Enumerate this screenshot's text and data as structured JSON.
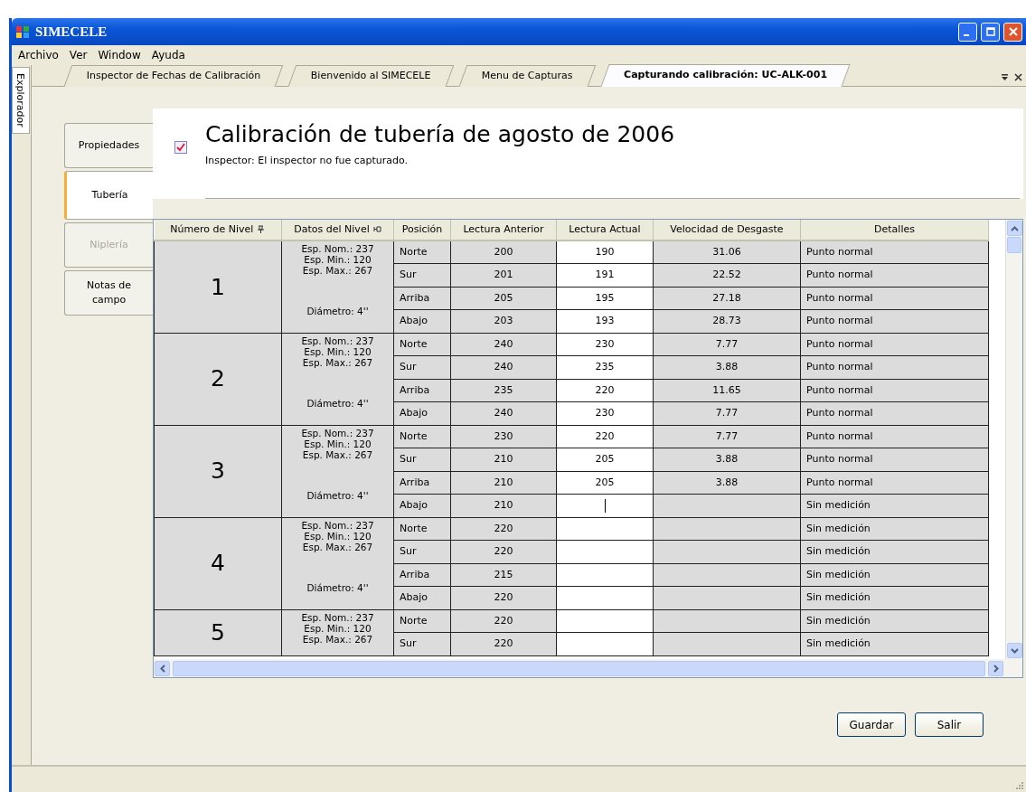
{
  "window": {
    "title": "SIMECELE"
  },
  "menu": [
    "Archivo",
    "Ver",
    "Window",
    "Ayuda"
  ],
  "side_panel": {
    "label": "Explorador"
  },
  "doc_tabs": [
    {
      "label": "Inspector de Fechas de Calibración",
      "selected": false
    },
    {
      "label": "Bienvenido al SIMECELE",
      "selected": false
    },
    {
      "label": "Menu  de Capturas",
      "selected": false
    },
    {
      "label": "Capturando calibración: UC-ALK-001",
      "selected": true
    }
  ],
  "section_tabs": [
    {
      "label": "Propiedades",
      "selected": false,
      "disabled": false
    },
    {
      "label": "Tubería",
      "selected": true,
      "disabled": false
    },
    {
      "label": "Niplería",
      "selected": false,
      "disabled": true
    },
    {
      "label": "Notas de campo",
      "selected": false,
      "disabled": false
    }
  ],
  "header": {
    "checked": true,
    "title": "Calibración de tubería de agosto de 2006",
    "subtitle": "Inspector: El inspector no fue capturado."
  },
  "grid": {
    "columns": [
      {
        "label": "Número de Nivel",
        "pinned": true
      },
      {
        "label": "Datos del Nivel",
        "pinned": true
      },
      {
        "label": "Posición",
        "pinned": false
      },
      {
        "label": "Lectura Anterior",
        "pinned": false
      },
      {
        "label": "Lectura Actual",
        "pinned": false
      },
      {
        "label": "Velocidad de Desgaste",
        "pinned": false
      },
      {
        "label": "Detalles",
        "pinned": false
      }
    ],
    "levels": [
      {
        "number": "1",
        "specs": [
          "Esp. Nom.: 237",
          "Esp. Min.: 120",
          "Esp. Max.: 267"
        ],
        "diameter": "Diámetro: 4''",
        "readings": [
          {
            "position": "Norte",
            "previous": "200",
            "current": "190",
            "rate": "31.06",
            "details": "Punto normal"
          },
          {
            "position": "Sur",
            "previous": "201",
            "current": "191",
            "rate": "22.52",
            "details": "Punto normal"
          },
          {
            "position": "Arriba",
            "previous": "205",
            "current": "195",
            "rate": "27.18",
            "details": "Punto normal"
          },
          {
            "position": "Abajo",
            "previous": "203",
            "current": "193",
            "rate": "28.73",
            "details": "Punto normal"
          }
        ]
      },
      {
        "number": "2",
        "specs": [
          "Esp. Nom.: 237",
          "Esp. Min.: 120",
          "Esp. Max.: 267"
        ],
        "diameter": "Diámetro: 4''",
        "readings": [
          {
            "position": "Norte",
            "previous": "240",
            "current": "230",
            "rate": "7.77",
            "details": "Punto normal"
          },
          {
            "position": "Sur",
            "previous": "240",
            "current": "235",
            "rate": "3.88",
            "details": "Punto normal"
          },
          {
            "position": "Arriba",
            "previous": "235",
            "current": "220",
            "rate": "11.65",
            "details": "Punto normal"
          },
          {
            "position": "Abajo",
            "previous": "240",
            "current": "230",
            "rate": "7.77",
            "details": "Punto normal"
          }
        ]
      },
      {
        "number": "3",
        "specs": [
          "Esp. Nom.: 237",
          "Esp. Min.: 120",
          "Esp. Max.: 267"
        ],
        "diameter": "Diámetro: 4''",
        "readings": [
          {
            "position": "Norte",
            "previous": "230",
            "current": "220",
            "rate": "7.77",
            "details": "Punto normal"
          },
          {
            "position": "Sur",
            "previous": "210",
            "current": "205",
            "rate": "3.88",
            "details": "Punto normal"
          },
          {
            "position": "Arriba",
            "previous": "210",
            "current": "205",
            "rate": "3.88",
            "details": "Punto normal"
          },
          {
            "position": "Abajo",
            "previous": "210",
            "editing": true,
            "details": "Sin medición"
          }
        ]
      },
      {
        "number": "4",
        "specs": [
          "Esp. Nom.: 237",
          "Esp. Min.: 120",
          "Esp. Max.: 267"
        ],
        "diameter": "Diámetro: 4''",
        "readings": [
          {
            "position": "Norte",
            "previous": "220",
            "details": "Sin medición"
          },
          {
            "position": "Sur",
            "previous": "220",
            "details": "Sin medición"
          },
          {
            "position": "Arriba",
            "previous": "215",
            "details": "Sin medición"
          },
          {
            "position": "Abajo",
            "previous": "220",
            "details": "Sin medición"
          }
        ]
      },
      {
        "number": "5",
        "specs": [
          "Esp. Nom.: 237",
          "Esp. Min.: 120",
          "Esp. Max.: 267"
        ],
        "readings": [
          {
            "position": "Norte",
            "previous": "220",
            "details": "Sin medición"
          },
          {
            "position": "Sur",
            "previous": "220",
            "details": "Sin medición"
          }
        ]
      }
    ]
  },
  "buttons": [
    "Guardar",
    "Salir"
  ]
}
